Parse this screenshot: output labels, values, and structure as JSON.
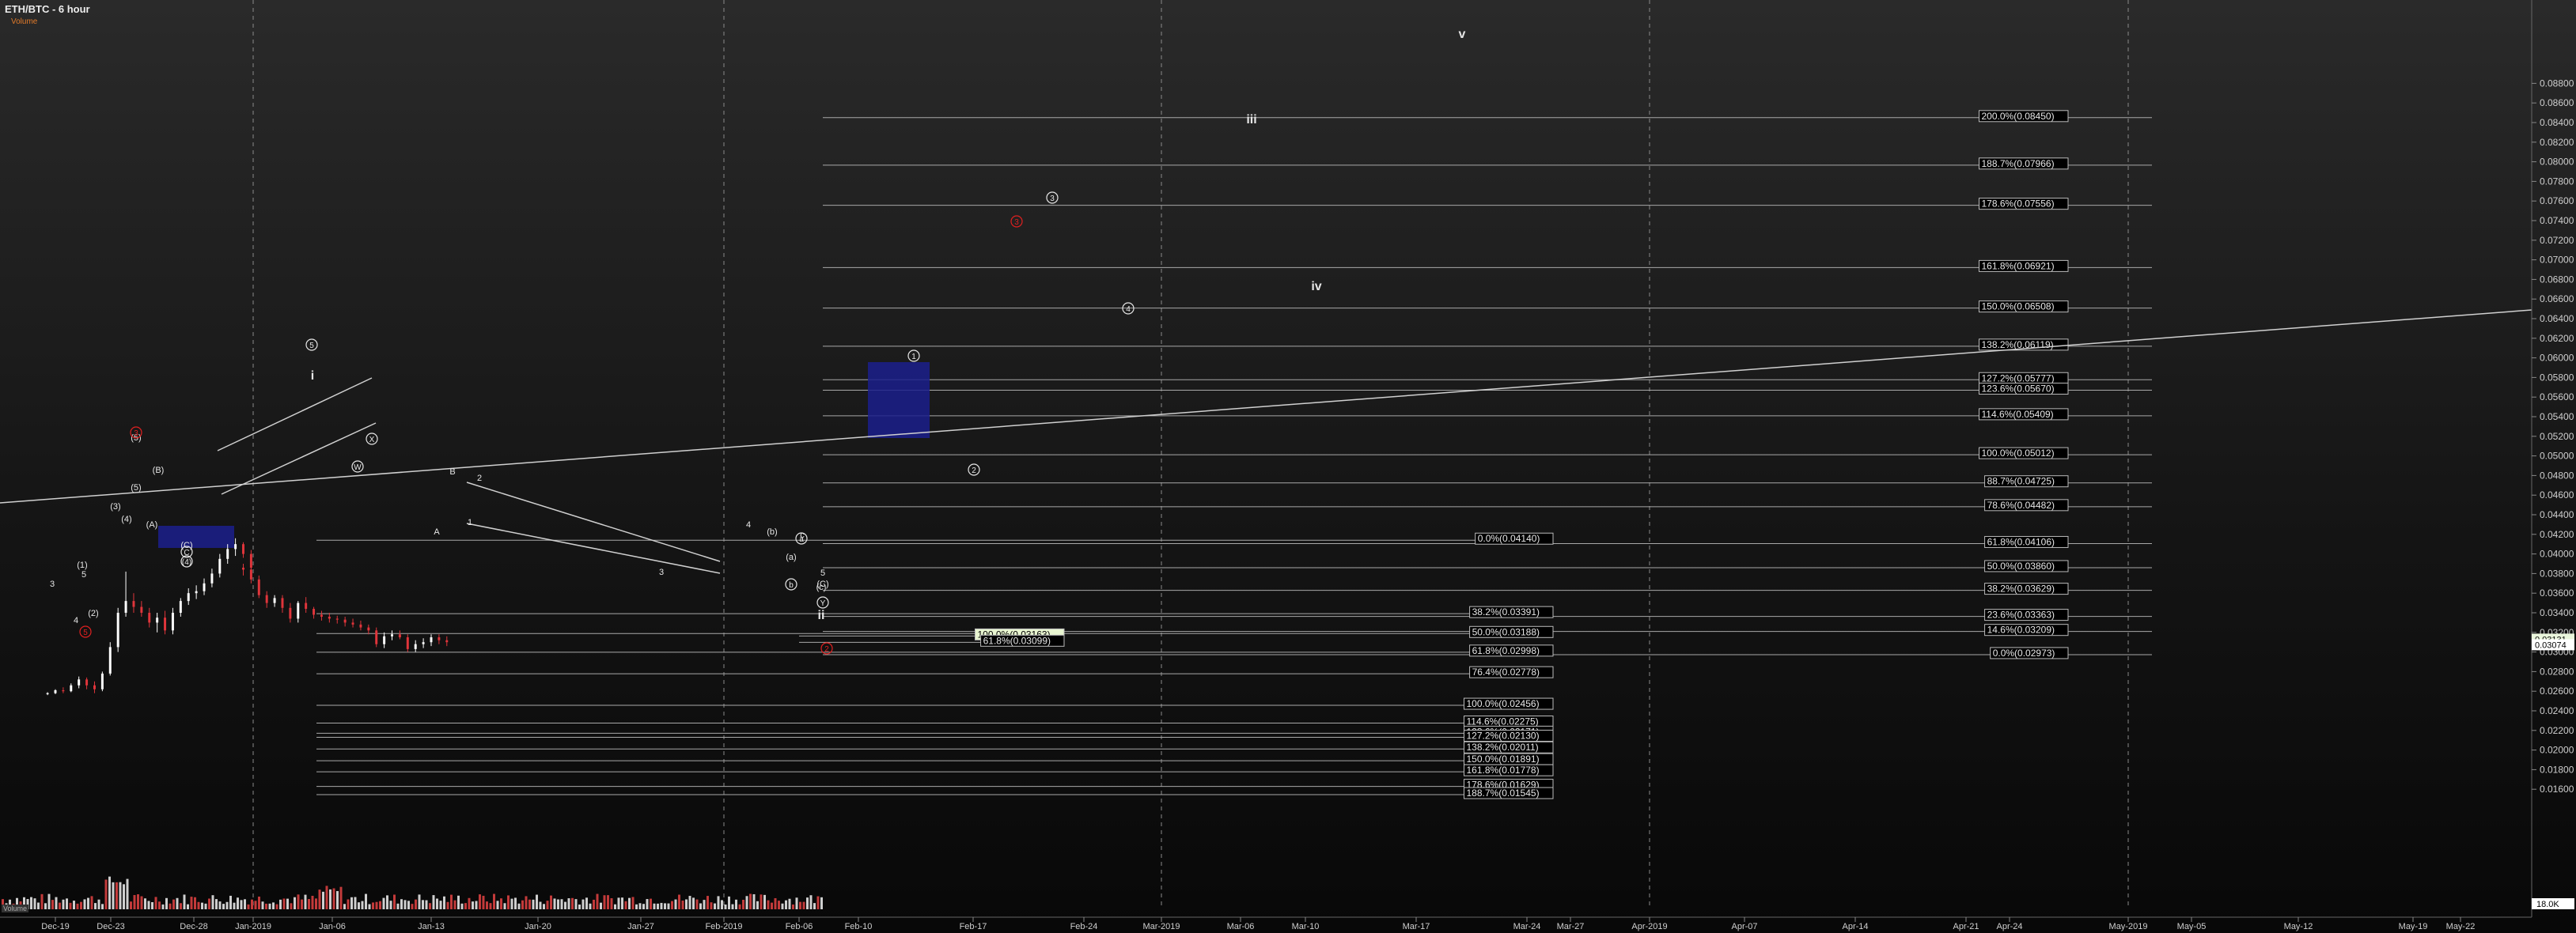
{
  "header": {
    "title": "ETH/BTC - 6 hour",
    "subtitle": "Volume"
  },
  "volume_label": "Volume",
  "colors": {
    "up": "#ffffff",
    "down": "#e0353b",
    "fib": "#bfbfbf",
    "box": "#1b1f8c",
    "wave_red": "#e02020"
  },
  "chart_data": {
    "type": "candlestick",
    "title": "ETH/BTC - 6 hour",
    "x_ticks": [
      "Dec-19",
      "Dec-23",
      "Dec-28",
      "Jan-2019",
      "Jan-06",
      "Jan-13",
      "Jan-20",
      "Jan-27",
      "Feb-2019",
      "Feb-06",
      "Feb-10",
      "Feb-17",
      "Feb-24",
      "Mar-2019",
      "Mar-06",
      "Mar-10",
      "Mar-17",
      "Mar-24",
      "Mar-27",
      "Apr-2019",
      "Apr-07",
      "Apr-14",
      "Apr-21",
      "Apr-24",
      "May-2019",
      "May-05",
      "May-12",
      "May-19",
      "May-22"
    ],
    "y_ticks": [
      "0.08800",
      "0.08600",
      "0.08400",
      "0.08200",
      "0.08000",
      "0.07800",
      "0.07600",
      "0.07400",
      "0.07200",
      "0.07000",
      "0.06800",
      "0.06600",
      "0.06400",
      "0.06200",
      "0.06000",
      "0.05800",
      "0.05600",
      "0.05400",
      "0.05200",
      "0.05000",
      "0.04800",
      "0.04600",
      "0.04400",
      "0.04200",
      "0.04000",
      "0.03800",
      "0.03600",
      "0.03400",
      "0.03200",
      "0.03000",
      "0.02800",
      "0.02600",
      "0.02400",
      "0.02200",
      "0.02000",
      "0.01800",
      "0.01600"
    ],
    "ylim": [
      0.0154,
      0.0885
    ],
    "price_labels": [
      "0.03131",
      "0.03074"
    ],
    "volume_label": "18.0K",
    "series": [
      {
        "name": "ETH/BTC",
        "points": [
          [
            "Dec-18 12:00",
            0.0257,
            0.0259,
            0.0256,
            0.0258
          ],
          [
            "Dec-19",
            0.0258,
            0.0262,
            0.0257,
            0.0261
          ],
          [
            "Dec-19 12:00",
            0.0261,
            0.0264,
            0.0258,
            0.026
          ],
          [
            "Dec-20",
            0.026,
            0.0268,
            0.0259,
            0.0266
          ],
          [
            "Dec-20 12:00",
            0.0266,
            0.0275,
            0.0263,
            0.0272
          ],
          [
            "Dec-21",
            0.0272,
            0.0274,
            0.0262,
            0.0266
          ],
          [
            "Dec-21 12:00",
            0.0266,
            0.027,
            0.0258,
            0.0262
          ],
          [
            "Dec-22",
            0.0262,
            0.028,
            0.026,
            0.0278
          ],
          [
            "Dec-22 12:00",
            0.0278,
            0.031,
            0.0276,
            0.0305
          ],
          [
            "Dec-23",
            0.0305,
            0.0345,
            0.03,
            0.034
          ],
          [
            "Dec-23 12:00",
            0.034,
            0.0382,
            0.0336,
            0.0352
          ],
          [
            "Dec-24",
            0.0352,
            0.036,
            0.034,
            0.0346
          ],
          [
            "Dec-24 12:00",
            0.0346,
            0.0352,
            0.0336,
            0.034
          ],
          [
            "Dec-25",
            0.034,
            0.0345,
            0.0325,
            0.033
          ],
          [
            "Dec-25 12:00",
            0.033,
            0.034,
            0.032,
            0.0335
          ],
          [
            "Dec-26",
            0.0335,
            0.0342,
            0.0318,
            0.0322
          ],
          [
            "Dec-26 12:00",
            0.0322,
            0.0345,
            0.0318,
            0.034
          ],
          [
            "Dec-27",
            0.034,
            0.0355,
            0.0336,
            0.0352
          ],
          [
            "Dec-27 12:00",
            0.0352,
            0.0365,
            0.0348,
            0.036
          ],
          [
            "Dec-28",
            0.036,
            0.0368,
            0.0354,
            0.0362
          ],
          [
            "Dec-28 12:00",
            0.0362,
            0.0375,
            0.0358,
            0.037
          ],
          [
            "Dec-29",
            0.037,
            0.0385,
            0.0366,
            0.038
          ],
          [
            "Dec-29 12:00",
            0.038,
            0.04,
            0.0376,
            0.0395
          ],
          [
            "Dec-30",
            0.0395,
            0.041,
            0.039,
            0.0405
          ],
          [
            "Dec-30 12:00",
            0.0405,
            0.0416,
            0.0398,
            0.041
          ],
          [
            "Dec-31",
            0.041,
            0.0412,
            0.0396,
            0.04
          ],
          [
            "Dec-31 12:00",
            0.04,
            0.0404,
            0.0382,
            0.0386
          ],
          [
            "Jan-01",
            0.0386,
            0.039,
            0.0378,
            0.0384
          ],
          [
            "Jan-01 12:00",
            0.0384,
            0.0388,
            0.037,
            0.0374
          ],
          [
            "Jan-02",
            0.0374,
            0.0378,
            0.0355,
            0.0358
          ],
          [
            "Jan-02 12:00",
            0.0358,
            0.0362,
            0.0345,
            0.035
          ],
          [
            "Jan-03",
            0.035,
            0.0358,
            0.0346,
            0.0355
          ],
          [
            "Jan-03 12:00",
            0.0355,
            0.0358,
            0.034,
            0.0345
          ],
          [
            "Jan-04",
            0.0345,
            0.035,
            0.033,
            0.0334
          ],
          [
            "Jan-04 12:00",
            0.0334,
            0.0352,
            0.033,
            0.035
          ],
          [
            "Jan-05",
            0.035,
            0.0356,
            0.034,
            0.0344
          ],
          [
            "Jan-05 12:00",
            0.0344,
            0.0346,
            0.0334,
            0.0338
          ],
          [
            "Jan-06",
            0.0338,
            0.0342,
            0.0332,
            0.0336
          ],
          [
            "Jan-06 12:00",
            0.0336,
            0.034,
            0.033,
            0.0334
          ],
          [
            "Jan-07",
            0.0334,
            0.0337,
            0.0329,
            0.0333
          ],
          [
            "Jan-07 12:00",
            0.0333,
            0.0336,
            0.0326,
            0.033
          ],
          [
            "Jan-08",
            0.033,
            0.0334,
            0.0325,
            0.0328
          ],
          [
            "Jan-08 12:00",
            0.0328,
            0.0332,
            0.0322,
            0.0325
          ],
          [
            "Jan-09",
            0.0325,
            0.0328,
            0.0318,
            0.0322
          ],
          [
            "Jan-09 12:00",
            0.0322,
            0.0325,
            0.0305,
            0.0308
          ],
          [
            "Jan-10",
            0.0308,
            0.032,
            0.0304,
            0.0316
          ],
          [
            "Jan-10 12:00",
            0.0316,
            0.0322,
            0.0312,
            0.0318
          ],
          [
            "Jan-11",
            0.0318,
            0.0322,
            0.0313,
            0.0315
          ],
          [
            "Jan-11 12:00",
            0.0315,
            0.0318,
            0.03,
            0.0303
          ],
          [
            "Jan-12",
            0.0303,
            0.0312,
            0.03,
            0.0308
          ],
          [
            "Jan-12 12:00",
            0.0308,
            0.0314,
            0.0304,
            0.031
          ],
          [
            "Jan-13",
            0.031,
            0.0318,
            0.0306,
            0.0315
          ],
          [
            "Jan-13 12:00",
            0.0315,
            0.0318,
            0.0308,
            0.0312
          ],
          [
            "Jan-14",
            0.0312,
            0.0316,
            0.0306,
            0.031
          ]
        ]
      },
      {
        "name": "Volume"
      }
    ],
    "fib_levels_right": [
      {
        "label": "200.0%(0.08450)",
        "price": 0.0845
      },
      {
        "label": "188.7%(0.07966)",
        "price": 0.07966
      },
      {
        "label": "178.6%(0.07556)",
        "price": 0.07556
      },
      {
        "label": "161.8%(0.06921)",
        "price": 0.06921
      },
      {
        "label": "150.0%(0.06508)",
        "price": 0.06508
      },
      {
        "label": "138.2%(0.06119)",
        "price": 0.06119
      },
      {
        "label": "127.2%(0.05777)",
        "price": 0.05777
      },
      {
        "label": "123.6%(0.05670)",
        "price": 0.0567
      },
      {
        "label": "114.6%(0.05409)",
        "price": 0.05409
      },
      {
        "label": "100.0%(0.05012)",
        "price": 0.05012
      },
      {
        "label": "88.7%(0.04725)",
        "price": 0.04725
      },
      {
        "label": "78.6%(0.04482)",
        "price": 0.04482
      },
      {
        "label": "61.8%(0.04106)",
        "price": 0.04106
      },
      {
        "label": "50.0%(0.03860)",
        "price": 0.0386
      },
      {
        "label": "38.2%(0.03629)",
        "price": 0.03629
      },
      {
        "label": "23.6%(0.03363)",
        "price": 0.03363
      },
      {
        "label": "14.6%(0.03209)",
        "price": 0.03209
      },
      {
        "label": "0.0%(0.02973)",
        "price": 0.02973
      }
    ],
    "fib_levels_mid": [
      {
        "label": "0.0%(0.04140)",
        "price": 0.0414
      },
      {
        "label": "38.2%(0.03391)",
        "price": 0.03391
      },
      {
        "label": "50.0%(0.03188)",
        "price": 0.03188
      },
      {
        "label": "61.8%(0.02998)",
        "price": 0.02998
      },
      {
        "label": "76.4%(0.02778)",
        "price": 0.02778
      },
      {
        "label": "100.0%(0.02456)",
        "price": 0.02456
      },
      {
        "label": "114.6%(0.02275)",
        "price": 0.02275
      },
      {
        "label": "123.6%(0.02171)",
        "price": 0.02171
      },
      {
        "label": "127.2%(0.02130)",
        "price": 0.0213
      },
      {
        "label": "138.2%(0.02011)",
        "price": 0.02011
      },
      {
        "label": "150.0%(0.01891)",
        "price": 0.01891
      },
      {
        "label": "161.8%(0.01778)",
        "price": 0.01778
      },
      {
        "label": "178.6%(0.01629)",
        "price": 0.01629
      },
      {
        "label": "188.7%(0.01545)",
        "price": 0.01545
      }
    ],
    "retrace_labels": [
      {
        "label": "100.0%(0.03163)",
        "price": 0.03163
      },
      {
        "label": "61.8%(0.03099)",
        "price": 0.03099
      }
    ],
    "wave_labels": [
      "i",
      "ii",
      "iii",
      "iv",
      "v",
      "1",
      "2",
      "3",
      "4",
      "5",
      "(A)",
      "(B)",
      "(C)",
      "(1)",
      "(2)",
      "(3)",
      "(4)",
      "(5)",
      "(a)",
      "(b)",
      "(c)",
      "W",
      "X",
      "Y",
      "a",
      "b",
      "c",
      "A",
      "B",
      "C",
      "3",
      "4",
      "5"
    ]
  }
}
